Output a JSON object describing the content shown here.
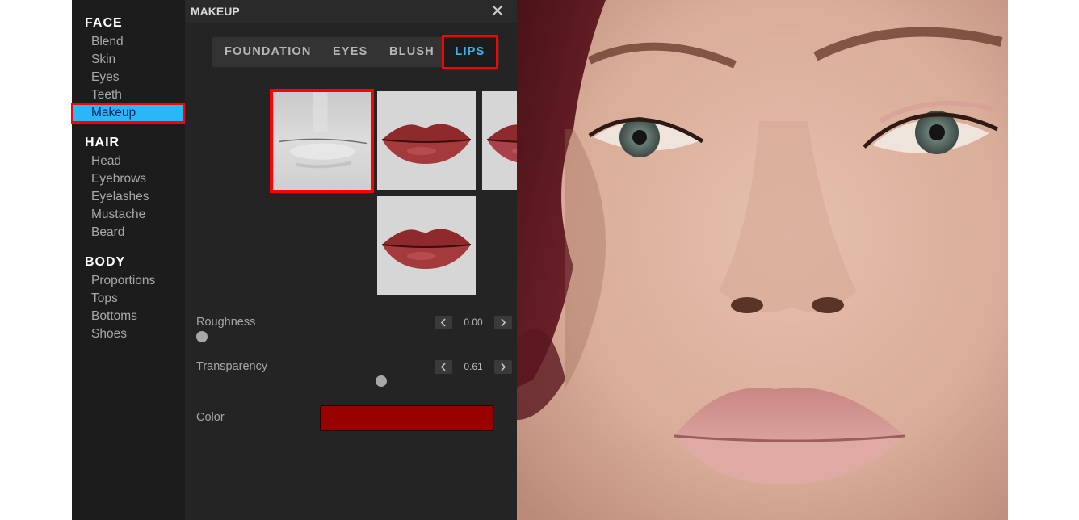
{
  "sidebar": {
    "sections": [
      {
        "title": "FACE",
        "items": [
          "Blend",
          "Skin",
          "Eyes",
          "Teeth",
          "Makeup"
        ]
      },
      {
        "title": "HAIR",
        "items": [
          "Head",
          "Eyebrows",
          "Eyelashes",
          "Mustache",
          "Beard"
        ]
      },
      {
        "title": "BODY",
        "items": [
          "Proportions",
          "Tops",
          "Bottoms",
          "Shoes"
        ]
      }
    ],
    "active_item": "Makeup"
  },
  "panel": {
    "title": "MAKEUP",
    "close_icon": "close-icon",
    "tabs": [
      {
        "label": "FOUNDATION",
        "active": false
      },
      {
        "label": "EYES",
        "active": false
      },
      {
        "label": "BLUSH",
        "active": false
      },
      {
        "label": "LIPS",
        "active": true
      }
    ],
    "presets": [
      {
        "name": "none",
        "selected": true
      },
      {
        "name": "red-lips-1",
        "selected": false
      },
      {
        "name": "red-lips-2",
        "selected": false
      },
      {
        "name": "red-lips-3",
        "selected": false
      }
    ],
    "params": {
      "roughness": {
        "label": "Roughness",
        "value": "0.00",
        "fraction": 0.0
      },
      "transparency": {
        "label": "Transparency",
        "value": "0.61",
        "fraction": 0.61
      },
      "color": {
        "label": "Color",
        "hex": "#990000"
      }
    },
    "stepper_icons": {
      "decrease": "chevron-left-icon",
      "increase": "chevron-right-icon"
    }
  },
  "colors": {
    "accent": "#2ab7f5",
    "tab_active_text": "#3fb1ee",
    "highlight": "#ff0000",
    "lip_color": "#990000"
  },
  "viewport": {
    "content": "3D face preview"
  }
}
